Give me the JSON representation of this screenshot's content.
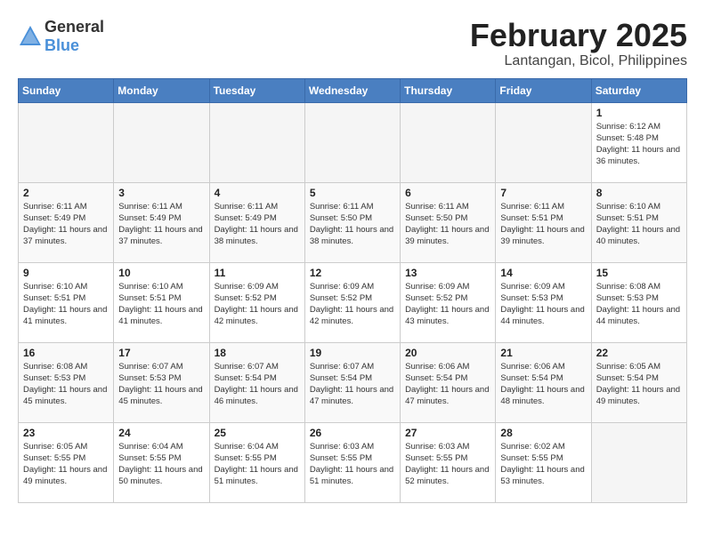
{
  "header": {
    "logo_general": "General",
    "logo_blue": "Blue",
    "month_year": "February 2025",
    "location": "Lantangan, Bicol, Philippines"
  },
  "days_of_week": [
    "Sunday",
    "Monday",
    "Tuesday",
    "Wednesday",
    "Thursday",
    "Friday",
    "Saturday"
  ],
  "weeks": [
    [
      {
        "day": "",
        "empty": true
      },
      {
        "day": "",
        "empty": true
      },
      {
        "day": "",
        "empty": true
      },
      {
        "day": "",
        "empty": true
      },
      {
        "day": "",
        "empty": true
      },
      {
        "day": "",
        "empty": true
      },
      {
        "day": "1",
        "sunrise": "6:12 AM",
        "sunset": "5:48 PM",
        "daylight": "Daylight: 11 hours and 36 minutes."
      }
    ],
    [
      {
        "day": "2",
        "sunrise": "6:11 AM",
        "sunset": "5:49 PM",
        "daylight": "Daylight: 11 hours and 37 minutes."
      },
      {
        "day": "3",
        "sunrise": "6:11 AM",
        "sunset": "5:49 PM",
        "daylight": "Daylight: 11 hours and 37 minutes."
      },
      {
        "day": "4",
        "sunrise": "6:11 AM",
        "sunset": "5:49 PM",
        "daylight": "Daylight: 11 hours and 38 minutes."
      },
      {
        "day": "5",
        "sunrise": "6:11 AM",
        "sunset": "5:50 PM",
        "daylight": "Daylight: 11 hours and 38 minutes."
      },
      {
        "day": "6",
        "sunrise": "6:11 AM",
        "sunset": "5:50 PM",
        "daylight": "Daylight: 11 hours and 39 minutes."
      },
      {
        "day": "7",
        "sunrise": "6:11 AM",
        "sunset": "5:51 PM",
        "daylight": "Daylight: 11 hours and 39 minutes."
      },
      {
        "day": "8",
        "sunrise": "6:10 AM",
        "sunset": "5:51 PM",
        "daylight": "Daylight: 11 hours and 40 minutes."
      }
    ],
    [
      {
        "day": "9",
        "sunrise": "6:10 AM",
        "sunset": "5:51 PM",
        "daylight": "Daylight: 11 hours and 41 minutes."
      },
      {
        "day": "10",
        "sunrise": "6:10 AM",
        "sunset": "5:51 PM",
        "daylight": "Daylight: 11 hours and 41 minutes."
      },
      {
        "day": "11",
        "sunrise": "6:09 AM",
        "sunset": "5:52 PM",
        "daylight": "Daylight: 11 hours and 42 minutes."
      },
      {
        "day": "12",
        "sunrise": "6:09 AM",
        "sunset": "5:52 PM",
        "daylight": "Daylight: 11 hours and 42 minutes."
      },
      {
        "day": "13",
        "sunrise": "6:09 AM",
        "sunset": "5:52 PM",
        "daylight": "Daylight: 11 hours and 43 minutes."
      },
      {
        "day": "14",
        "sunrise": "6:09 AM",
        "sunset": "5:53 PM",
        "daylight": "Daylight: 11 hours and 44 minutes."
      },
      {
        "day": "15",
        "sunrise": "6:08 AM",
        "sunset": "5:53 PM",
        "daylight": "Daylight: 11 hours and 44 minutes."
      }
    ],
    [
      {
        "day": "16",
        "sunrise": "6:08 AM",
        "sunset": "5:53 PM",
        "daylight": "Daylight: 11 hours and 45 minutes."
      },
      {
        "day": "17",
        "sunrise": "6:07 AM",
        "sunset": "5:53 PM",
        "daylight": "Daylight: 11 hours and 45 minutes."
      },
      {
        "day": "18",
        "sunrise": "6:07 AM",
        "sunset": "5:54 PM",
        "daylight": "Daylight: 11 hours and 46 minutes."
      },
      {
        "day": "19",
        "sunrise": "6:07 AM",
        "sunset": "5:54 PM",
        "daylight": "Daylight: 11 hours and 47 minutes."
      },
      {
        "day": "20",
        "sunrise": "6:06 AM",
        "sunset": "5:54 PM",
        "daylight": "Daylight: 11 hours and 47 minutes."
      },
      {
        "day": "21",
        "sunrise": "6:06 AM",
        "sunset": "5:54 PM",
        "daylight": "Daylight: 11 hours and 48 minutes."
      },
      {
        "day": "22",
        "sunrise": "6:05 AM",
        "sunset": "5:54 PM",
        "daylight": "Daylight: 11 hours and 49 minutes."
      }
    ],
    [
      {
        "day": "23",
        "sunrise": "6:05 AM",
        "sunset": "5:55 PM",
        "daylight": "Daylight: 11 hours and 49 minutes."
      },
      {
        "day": "24",
        "sunrise": "6:04 AM",
        "sunset": "5:55 PM",
        "daylight": "Daylight: 11 hours and 50 minutes."
      },
      {
        "day": "25",
        "sunrise": "6:04 AM",
        "sunset": "5:55 PM",
        "daylight": "Daylight: 11 hours and 51 minutes."
      },
      {
        "day": "26",
        "sunrise": "6:03 AM",
        "sunset": "5:55 PM",
        "daylight": "Daylight: 11 hours and 51 minutes."
      },
      {
        "day": "27",
        "sunrise": "6:03 AM",
        "sunset": "5:55 PM",
        "daylight": "Daylight: 11 hours and 52 minutes."
      },
      {
        "day": "28",
        "sunrise": "6:02 AM",
        "sunset": "5:55 PM",
        "daylight": "Daylight: 11 hours and 53 minutes."
      },
      {
        "day": "",
        "empty": true
      }
    ]
  ]
}
